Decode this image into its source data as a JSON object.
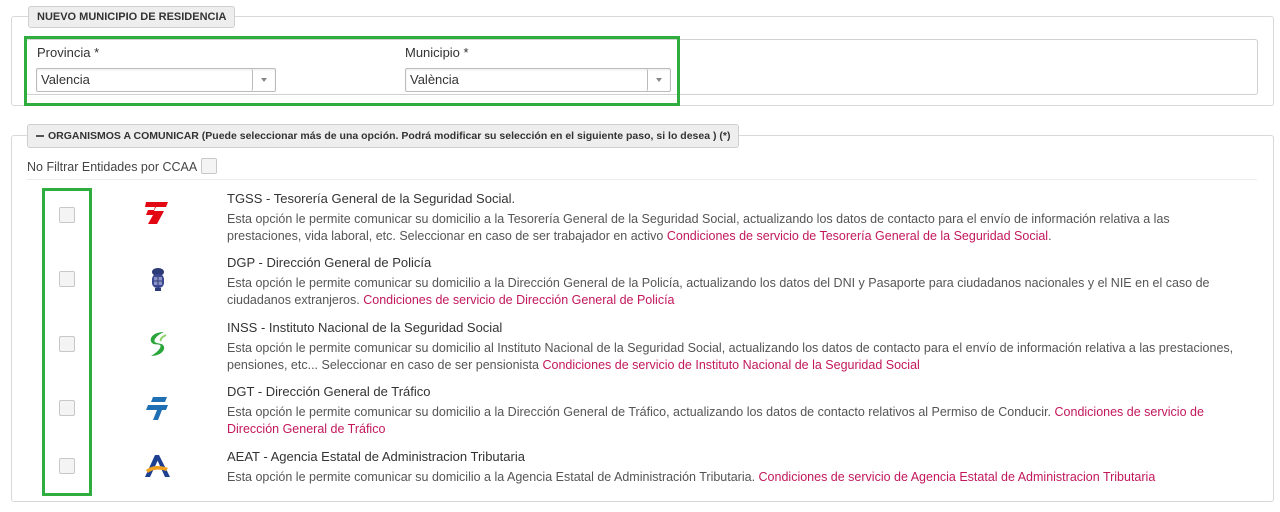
{
  "residence": {
    "legend": "NUEVO MUNICIPIO DE RESIDENCIA",
    "provincia_label": "Provincia *",
    "provincia_value": "Valencia",
    "municipio_label": "Municipio *",
    "municipio_value": "València"
  },
  "organismos": {
    "legend": "ORGANISMOS A COMUNICAR (Puede seleccionar más de una opción. Podrá modificar su selección en el siguiente paso, si lo desea ) (*)",
    "filter_label": "No Filtrar Entidades por CCAA",
    "items": [
      {
        "title": "TGSS - Tesorería General de la Seguridad Social.",
        "desc": "Esta opción le permite comunicar su domicilio a la Tesorería General de la Seguridad Social, actualizando los datos de contacto para el envío de información relativa a las prestaciones, vida laboral, etc. Seleccionar en caso de ser trabajador en activo",
        "link": "Condiciones de servicio de Tesorería General de la Seguridad Social",
        "link_suffix": ".",
        "logo": "tgss-logo"
      },
      {
        "title": "DGP - Dirección General de Policía",
        "desc": "Esta opción le permite comunicar su domicilio a la Dirección General de la Policía, actualizando los datos del DNI y Pasaporte para ciudadanos nacionales y el NIE en el caso de ciudadanos extranjeros.",
        "link": "Condiciones de servicio de Dirección General de Policía",
        "link_suffix": "",
        "logo": "police-crest-logo"
      },
      {
        "title": "INSS - Instituto Nacional de la Seguridad Social",
        "desc": "Esta opción le permite comunicar su domicilio al Instituto Nacional de la Seguridad Social, actualizando los datos de contacto para el envío de información relativa a las prestaciones, pensiones, etc... Seleccionar en caso de ser pensionista",
        "link": "Condiciones de servicio de Instituto Nacional de la Seguridad Social",
        "link_suffix": "",
        "logo": "inss-logo"
      },
      {
        "title": "DGT - Dirección General de Tráfico",
        "desc": "Esta opción le permite comunicar su domicilio a la Dirección General de Tráfico, actualizando los datos de contacto relativos al Permiso de Conducir.",
        "link": "Condiciones de servicio de Dirección General de Tráfico",
        "link_suffix": "",
        "logo": "dgt-logo"
      },
      {
        "title": "AEAT - Agencia Estatal de Administracion Tributaria",
        "desc": "Esta opción le permite comunicar su domicilio a la Agencia Estatal de Administración Tributaria.",
        "link": "Condiciones de servicio de Agencia Estatal de Administracion Tributaria",
        "link_suffix": "",
        "logo": "aeat-logo"
      }
    ]
  },
  "colors": {
    "highlight": "#2fae3f",
    "link": "#c2185b",
    "tgss": "#e30613",
    "inss": "#2aa53a",
    "dgt": "#1f6fb5",
    "aeat_blue": "#1c3f8f",
    "aeat_orange": "#f0a020"
  }
}
